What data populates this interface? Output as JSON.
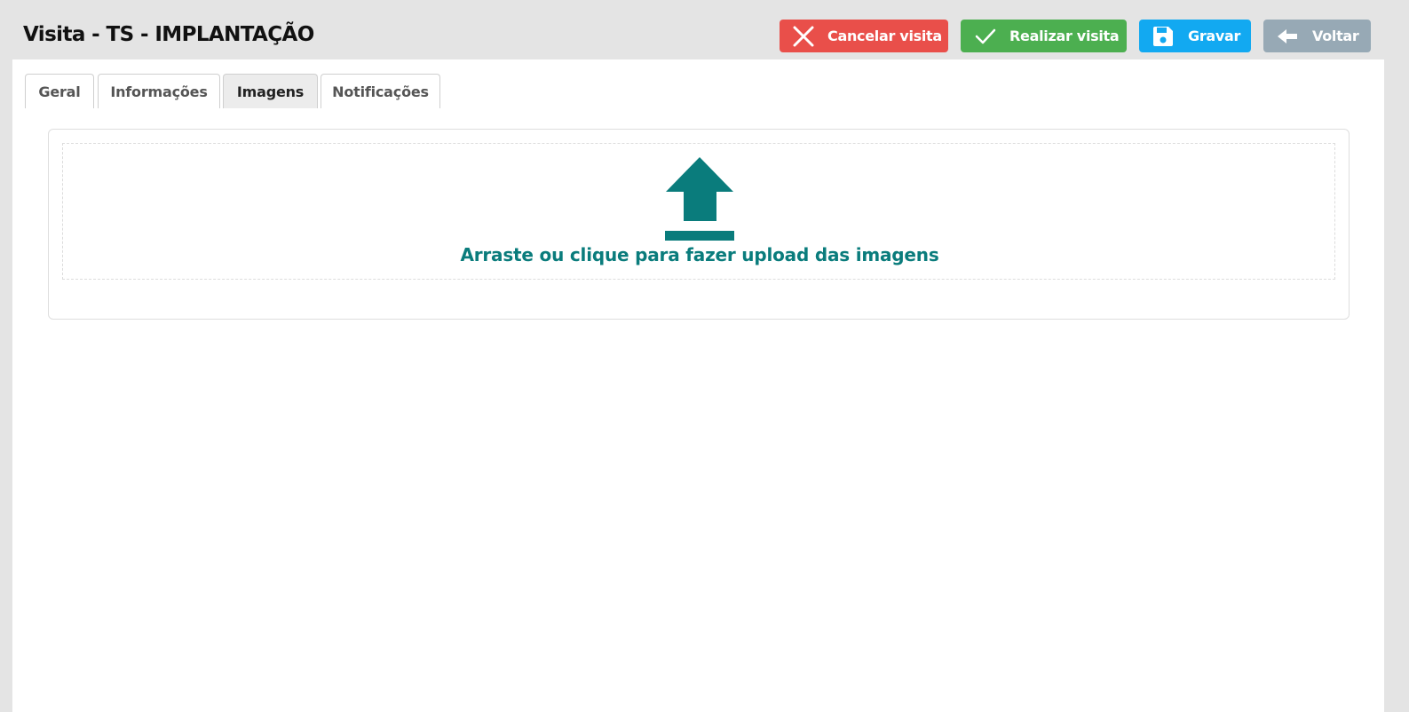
{
  "header": {
    "title": "Visita - TS - IMPLANTAÇÃO",
    "buttons": {
      "cancel": {
        "label": "Cancelar visita",
        "icon": "close-icon",
        "color": "#e94f4a"
      },
      "realizar": {
        "label": "Realizar visita",
        "icon": "check-icon",
        "color": "#4caf50"
      },
      "gravar": {
        "label": "Gravar",
        "icon": "save-icon",
        "color": "#12a9f1"
      },
      "voltar": {
        "label": "Voltar",
        "icon": "arrow-left-icon",
        "color": "#97a9b5"
      }
    }
  },
  "tabs": [
    {
      "label": "Geral",
      "active": false
    },
    {
      "label": "Informações",
      "active": false
    },
    {
      "label": "Imagens",
      "active": true
    },
    {
      "label": "Notificações",
      "active": false
    }
  ],
  "upload": {
    "icon": "upload-icon",
    "text": "Arraste ou clique para fazer upload das imagens",
    "accent_color": "#0a7c7c"
  }
}
